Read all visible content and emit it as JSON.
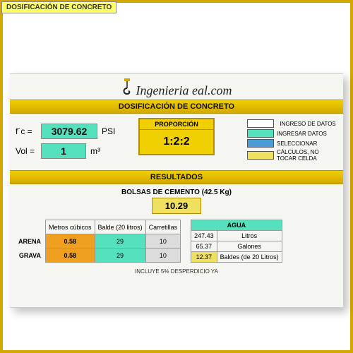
{
  "top_tag": "DOSIFICACIÓN DE CONCRETO",
  "brand": "Ingenieria  eal.com",
  "banner_main": "DOSIFICACIÓN DE CONCRETO",
  "banner_results": "RESULTADOS",
  "inputs": {
    "fc_label": "f´c =",
    "fc_value": "3079.62",
    "fc_unit": "PSI",
    "vol_label": "Vol =",
    "vol_value": "1",
    "vol_unit": "m³"
  },
  "proportion": {
    "label": "PROPORCIÓN",
    "value": "1:2:2"
  },
  "legend": {
    "ingreso": "INGRESO DE DATOS",
    "ingresar": "INGRESAR DATOS",
    "seleccionar": "SELECCIONAR",
    "calculos": "CÁLCULOS, NO TOCAR CELDA"
  },
  "bolsas": {
    "label": "BOLSAS DE CEMENTO (42.5 Kg)",
    "value": "10.29"
  },
  "materials": {
    "headers": [
      "Metros cúbicos",
      "Balde (20 litros)",
      "Carretillas"
    ],
    "rows": [
      {
        "name": "ARENA",
        "m3": "0.58",
        "balde": "29",
        "carretillas": "10"
      },
      {
        "name": "GRAVA",
        "m3": "0.58",
        "balde": "29",
        "carretillas": "10"
      }
    ]
  },
  "agua": {
    "title": "AGUA",
    "rows": [
      {
        "val": "247.43",
        "unit": "Litros"
      },
      {
        "val": "65.37",
        "unit": "Galones"
      },
      {
        "val": "12.37",
        "unit": "Baldes (de 20 Litros)"
      }
    ]
  },
  "footnote": "INCLUYE 5% DESPERDICIO YA"
}
